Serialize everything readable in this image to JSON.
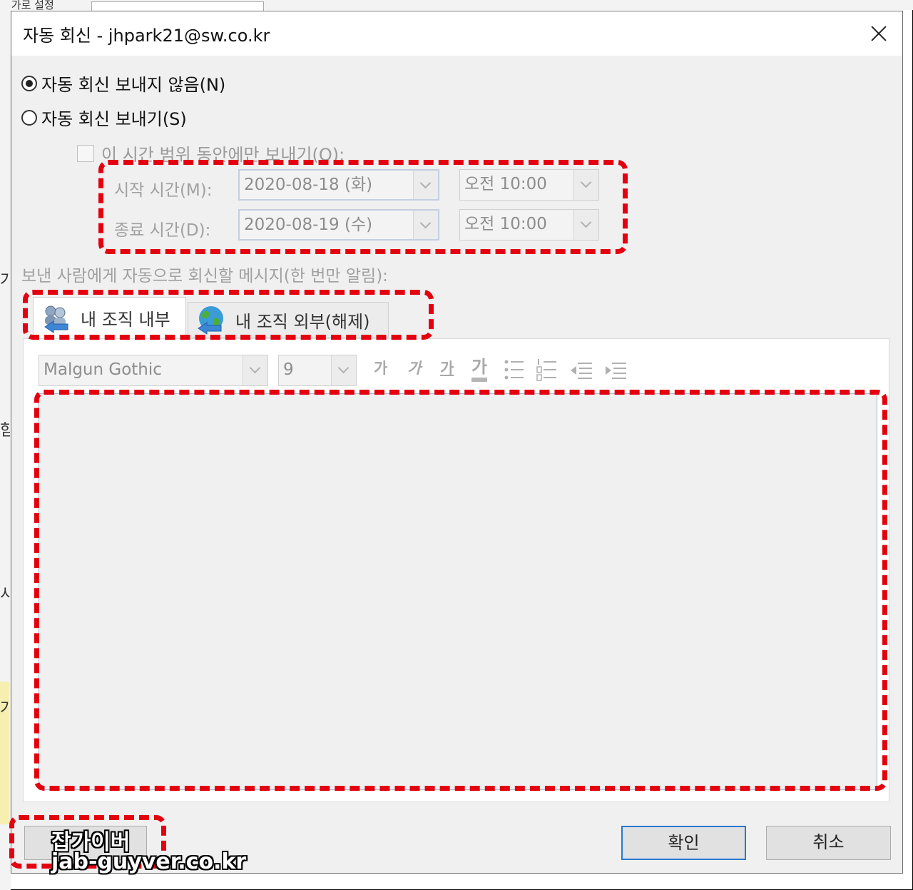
{
  "background": {
    "top_label": "추가로 설정"
  },
  "window": {
    "title": "자동 회신 - jhpark21@sw.co.kr"
  },
  "options": {
    "no_reply": "자동 회신 보내지 않음(N)",
    "send_reply": "자동 회신 보내기(S)",
    "time_range": "이 시간 범위 동안에만 보내기(O):"
  },
  "schedule": {
    "start_label": "시작 시간(M):",
    "start_date": "2020-08-18 (화)",
    "start_time": "오전 10:00",
    "end_label": "종료 시간(D):",
    "end_date": "2020-08-19 (수)",
    "end_time": "오전 10:00"
  },
  "message_label": "보낸 사람에게 자동으로 회신할 메시지(한 번만 알림):",
  "tabs": {
    "inside": "내 조직 내부",
    "outside": "내 조직 외부(해제)"
  },
  "toolbar": {
    "font": "Malgun Gothic",
    "size": "9",
    "bold": "가",
    "italic": "가",
    "underline": "가",
    "color": "가"
  },
  "buttons": {
    "ok": "확인",
    "cancel": "취소"
  },
  "watermark": {
    "line1": "잡가이버",
    "line2": "jab-guyver.co.kr"
  },
  "colors": {
    "highlight": "#e4000f",
    "primary_border": "#2a78d0"
  }
}
